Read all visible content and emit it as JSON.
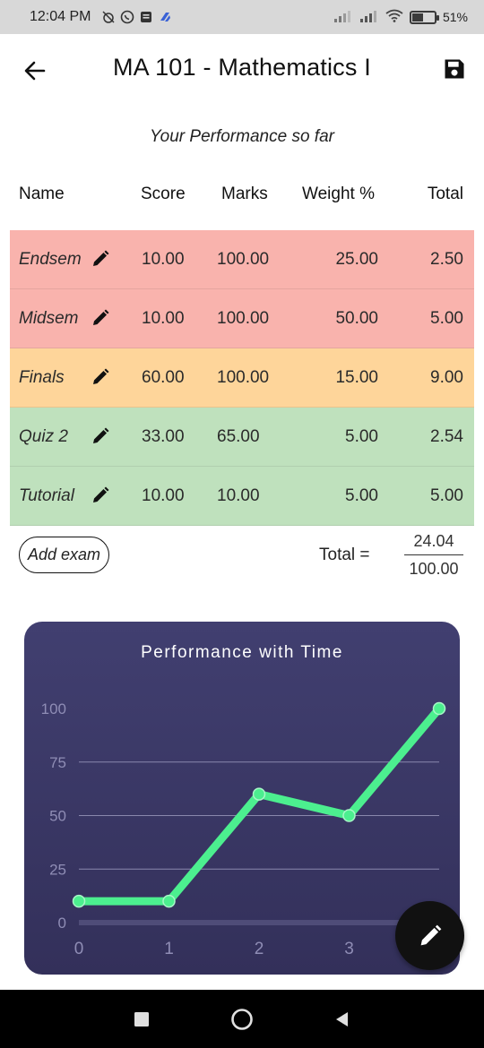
{
  "status_bar": {
    "time": "12:04 PM",
    "battery": "51%"
  },
  "app_bar": {
    "title": "MA 101 - Mathematics I"
  },
  "subtitle": "Your Performance so far",
  "table": {
    "headers": [
      "Name",
      "Score",
      "Marks",
      "Weight %",
      "Total"
    ],
    "rows": [
      {
        "name": "Endsem",
        "score": "10.00",
        "marks": "100.00",
        "weight": "25.00",
        "total": "2.50",
        "status_color": "#f9b3ad"
      },
      {
        "name": "Midsem",
        "score": "10.00",
        "marks": "100.00",
        "weight": "50.00",
        "total": "5.00",
        "status_color": "#f9b3ad"
      },
      {
        "name": "Finals",
        "score": "60.00",
        "marks": "100.00",
        "weight": "15.00",
        "total": "9.00",
        "status_color": "#fed59a"
      },
      {
        "name": "Quiz 2",
        "score": "33.00",
        "marks": "65.00",
        "weight": "5.00",
        "total": "2.54",
        "status_color": "#bfe1bd"
      },
      {
        "name": "Tutorial",
        "score": "10.00",
        "marks": "10.00",
        "weight": "5.00",
        "total": "5.00",
        "status_color": "#bfe1bd"
      }
    ]
  },
  "add_exam_label": "Add exam",
  "total": {
    "label": "Total =",
    "obtained": "24.04",
    "maximum": "100.00"
  },
  "chart_data": {
    "type": "line",
    "title": "Performance with Time",
    "x": [
      0,
      1,
      2,
      3,
      4
    ],
    "x_tick_labels": [
      "0",
      "1",
      "2",
      "3"
    ],
    "series": [
      {
        "values": [
          10,
          10,
          60,
          50,
          100
        ],
        "color": "#4cef8f"
      }
    ],
    "y_tick_labels": [
      "0",
      "25",
      "50",
      "75",
      "100"
    ],
    "ylim": [
      0,
      100
    ],
    "xlim": [
      0,
      4
    ],
    "grid": true
  },
  "colors": {
    "low": "#f9b3ad",
    "mid": "#fed59a",
    "high": "#bfe1bd",
    "chart_bg": "#3a375f",
    "line": "#4cef8f"
  },
  "icons": {
    "back": "arrow-left-icon",
    "save": "floppy-disk-icon",
    "edit": "pencil-icon",
    "fab": "pencil-icon"
  }
}
